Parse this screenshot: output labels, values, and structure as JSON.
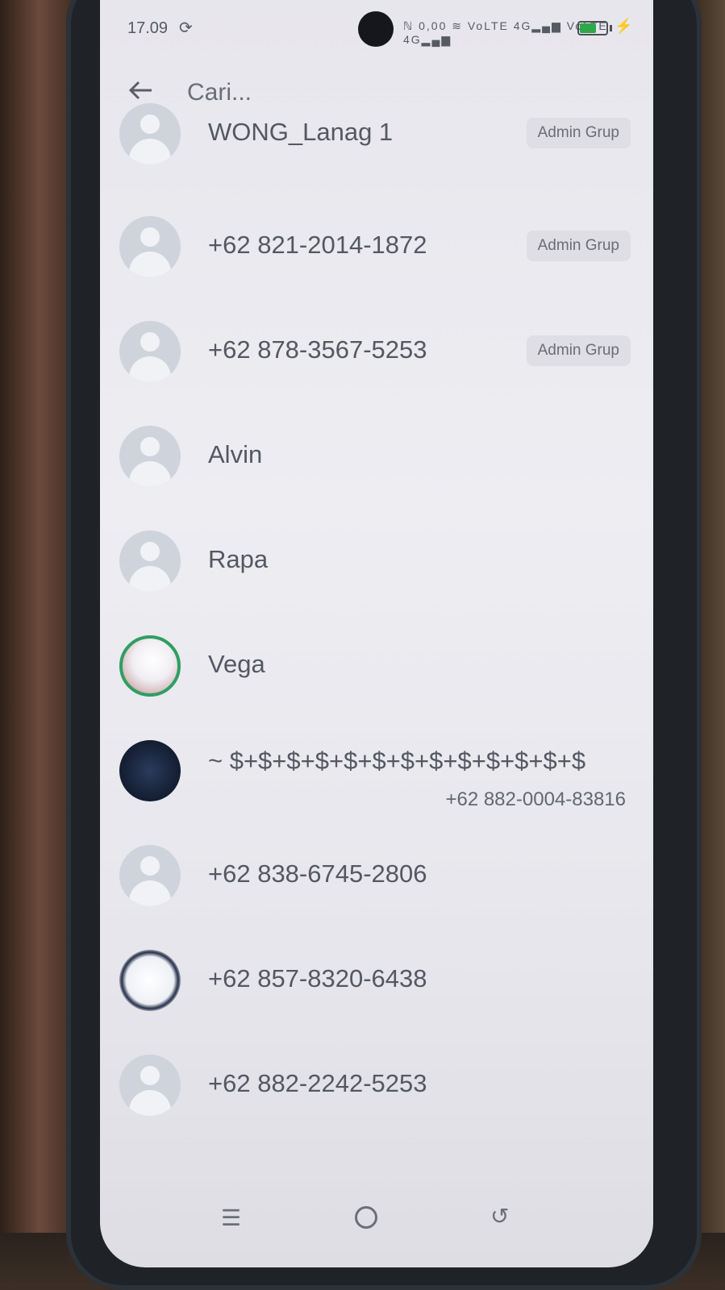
{
  "status_bar": {
    "time": "17.09",
    "icons_text": "NFC 0,00 Wi-Fi VoLTE 4G VoLTE 4G",
    "battery_level": "62",
    "battery_fraction": 0.6,
    "accent_color": "#2fa84a"
  },
  "header": {
    "back_icon": "arrow-left-icon",
    "search_placeholder": "Cari..."
  },
  "contacts": [
    {
      "name": "WONG_Lanag 1",
      "badge": "Admin Grup",
      "avatar": "default"
    },
    {
      "name": "+62 821-2014-1872",
      "badge": "Admin Grup",
      "avatar": "default"
    },
    {
      "name": "+62 878-3567-5253",
      "badge": "Admin Grup",
      "avatar": "default"
    },
    {
      "name": "Alvin",
      "avatar": "default"
    },
    {
      "name": "Rapa",
      "avatar": "default"
    },
    {
      "name": "Vega",
      "avatar": "photo"
    },
    {
      "name": "~ $+$+$+$+$+$+$+$+$+$+$+$+$",
      "phone": "+62 882-0004-83816",
      "avatar": "photo"
    },
    {
      "name": "+62 838-6745-2806",
      "avatar": "default"
    },
    {
      "name": "+62 857-8320-6438",
      "avatar": "photo"
    },
    {
      "name": "+62 882-2242-5253",
      "avatar": "default"
    }
  ],
  "nav_bar": {
    "menu_icon": "menu-icon",
    "home_icon": "home-icon",
    "back_icon": "back-icon"
  }
}
